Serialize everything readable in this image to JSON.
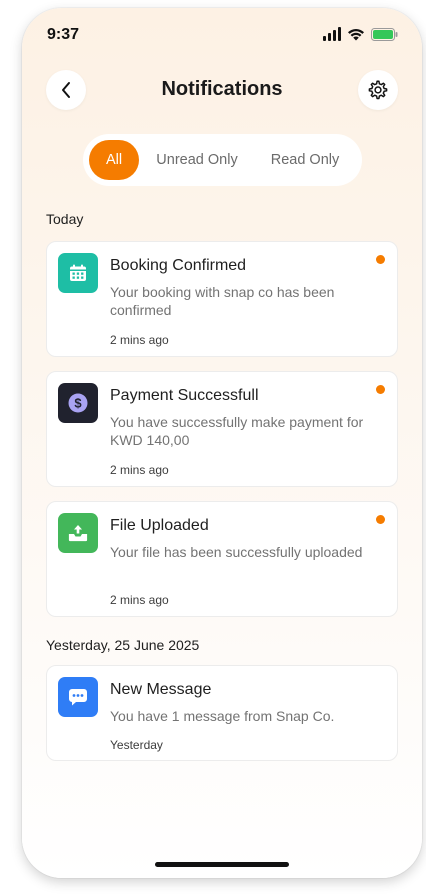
{
  "status_bar": {
    "time": "9:37"
  },
  "header": {
    "title": "Notifications"
  },
  "filters": {
    "tabs": [
      {
        "label": "All",
        "active": true
      },
      {
        "label": "Unread Only",
        "active": false
      },
      {
        "label": "Read Only",
        "active": false
      }
    ]
  },
  "sections": [
    {
      "label": "Today",
      "notifications": [
        {
          "title": "Booking Confirmed",
          "body": "Your booking with snap co has been confirmed",
          "time": "2 mins ago",
          "unread": true,
          "icon": "calendar-icon",
          "icon_color": "#1ebea5"
        },
        {
          "title": "Payment Successfull",
          "body": "You have successfully make payment for KWD 140,00",
          "time": "2 mins ago",
          "unread": true,
          "icon": "dollar-icon",
          "icon_color": "#20222e"
        },
        {
          "title": "File Uploaded",
          "body": "Your file has been successfully uploaded",
          "time": "2 mins ago",
          "unread": true,
          "icon": "upload-icon",
          "icon_color": "#43b75a"
        }
      ]
    },
    {
      "label": "Yesterday, 25 June 2025",
      "notifications": [
        {
          "title": "New Message",
          "body": "You have 1 message from Snap Co.",
          "time": "Yesterday",
          "unread": false,
          "icon": "chat-icon",
          "icon_color": "#2f7df6"
        }
      ]
    }
  ],
  "colors": {
    "accent": "#f57c00",
    "background_top": "#fdf1e4"
  }
}
